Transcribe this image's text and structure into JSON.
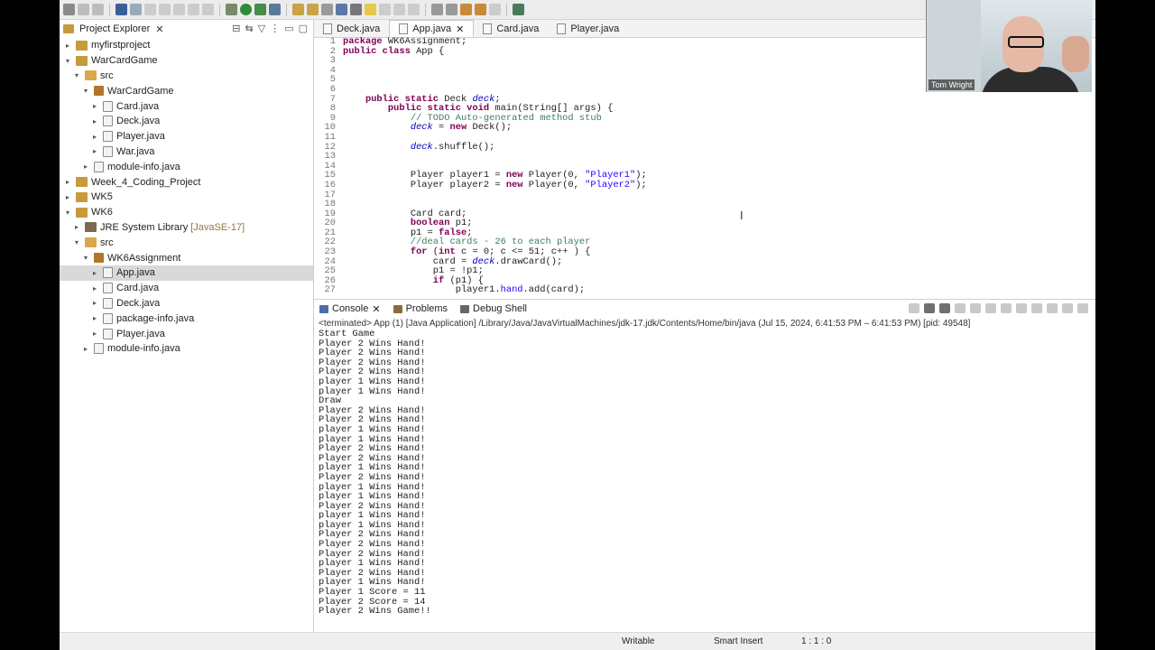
{
  "explorer": {
    "title": "Project Explorer",
    "tree": [
      {
        "label": "myfirstproject",
        "indent": 0,
        "chevron": "›",
        "icon": "proj"
      },
      {
        "label": "WarCardGame",
        "indent": 0,
        "chevron": "⌄",
        "icon": "proj"
      },
      {
        "label": "src",
        "indent": 1,
        "chevron": "⌄",
        "icon": "folder"
      },
      {
        "label": "WarCardGame",
        "indent": 2,
        "chevron": "⌄",
        "icon": "pkg"
      },
      {
        "label": "Card.java",
        "indent": 3,
        "chevron": "›",
        "icon": "file"
      },
      {
        "label": "Deck.java",
        "indent": 3,
        "chevron": "›",
        "icon": "file"
      },
      {
        "label": "Player.java",
        "indent": 3,
        "chevron": "›",
        "icon": "file"
      },
      {
        "label": "War.java",
        "indent": 3,
        "chevron": "›",
        "icon": "file"
      },
      {
        "label": "module-info.java",
        "indent": 2,
        "chevron": "›",
        "icon": "file"
      },
      {
        "label": "Week_4_Coding_Project",
        "indent": 0,
        "chevron": "›",
        "icon": "proj"
      },
      {
        "label": "WK5",
        "indent": 0,
        "chevron": "›",
        "icon": "proj"
      },
      {
        "label": "WK6",
        "indent": 0,
        "chevron": "⌄",
        "icon": "proj"
      },
      {
        "label": "JRE System Library",
        "suffix": "[JavaSE-17]",
        "indent": 1,
        "chevron": "›",
        "icon": "lib"
      },
      {
        "label": "src",
        "indent": 1,
        "chevron": "⌄",
        "icon": "folder"
      },
      {
        "label": "WK6Assignment",
        "indent": 2,
        "chevron": "⌄",
        "icon": "pkg"
      },
      {
        "label": "App.java",
        "indent": 3,
        "chevron": "›",
        "icon": "file",
        "selected": true
      },
      {
        "label": "Card.java",
        "indent": 3,
        "chevron": "›",
        "icon": "file"
      },
      {
        "label": "Deck.java",
        "indent": 3,
        "chevron": "›",
        "icon": "file"
      },
      {
        "label": "package-info.java",
        "indent": 3,
        "chevron": "›",
        "icon": "file"
      },
      {
        "label": "Player.java",
        "indent": 3,
        "chevron": "›",
        "icon": "file"
      },
      {
        "label": "module-info.java",
        "indent": 2,
        "chevron": "›",
        "icon": "file"
      }
    ]
  },
  "editor": {
    "tabs": [
      {
        "label": "Deck.java",
        "active": false
      },
      {
        "label": "App.java",
        "active": true
      },
      {
        "label": "Card.java",
        "active": false
      },
      {
        "label": "Player.java",
        "active": false
      }
    ],
    "code": [
      {
        "n": "1",
        "tokens": [
          [
            "kw",
            "package"
          ],
          [
            "ct",
            " WK6Assignment;"
          ]
        ]
      },
      {
        "n": "2",
        "tokens": [
          [
            "kw",
            "public class"
          ],
          [
            "ct",
            " App {"
          ]
        ]
      },
      {
        "n": "3",
        "tokens": []
      },
      {
        "n": "4",
        "tokens": []
      },
      {
        "n": "5",
        "tokens": []
      },
      {
        "n": "6",
        "tokens": []
      },
      {
        "n": "7",
        "tokens": [
          [
            "ct",
            "    "
          ],
          [
            "kw",
            "public static"
          ],
          [
            "ct",
            " Deck "
          ],
          [
            "fl",
            "deck"
          ],
          [
            "ct",
            ";"
          ]
        ]
      },
      {
        "n": "8",
        "tokens": [
          [
            "ct",
            "        "
          ],
          [
            "kw",
            "public static void"
          ],
          [
            "ct",
            " main(String[] args) {"
          ]
        ]
      },
      {
        "n": "9",
        "tokens": [
          [
            "ct",
            "            "
          ],
          [
            "cm",
            "// TODO Auto-generated method stub"
          ]
        ]
      },
      {
        "n": "10",
        "tokens": [
          [
            "ct",
            "            "
          ],
          [
            "fl",
            "deck"
          ],
          [
            "ct",
            " = "
          ],
          [
            "kw",
            "new"
          ],
          [
            "ct",
            " Deck();"
          ]
        ]
      },
      {
        "n": "11",
        "tokens": []
      },
      {
        "n": "12",
        "tokens": [
          [
            "ct",
            "            "
          ],
          [
            "fl",
            "deck"
          ],
          [
            "ct",
            ".shuffle();"
          ]
        ]
      },
      {
        "n": "13",
        "tokens": []
      },
      {
        "n": "14",
        "tokens": []
      },
      {
        "n": "15",
        "tokens": [
          [
            "ct",
            "            Player player1 = "
          ],
          [
            "kw",
            "new"
          ],
          [
            "ct",
            " Player(0, "
          ],
          [
            "st",
            "\"Player1\""
          ],
          [
            "ct",
            ");"
          ]
        ]
      },
      {
        "n": "16",
        "tokens": [
          [
            "ct",
            "            Player player2 = "
          ],
          [
            "kw",
            "new"
          ],
          [
            "ct",
            " Player(0, "
          ],
          [
            "st",
            "\"Player2\""
          ],
          [
            "ct",
            ");"
          ]
        ]
      },
      {
        "n": "17",
        "tokens": []
      },
      {
        "n": "18",
        "tokens": []
      },
      {
        "n": "19",
        "tokens": [
          [
            "ct",
            "            Card card;"
          ]
        ]
      },
      {
        "n": "20",
        "tokens": [
          [
            "ct",
            "            "
          ],
          [
            "kw",
            "boolean"
          ],
          [
            "ct",
            " p1;"
          ]
        ]
      },
      {
        "n": "21",
        "tokens": [
          [
            "ct",
            "            p1 = "
          ],
          [
            "kw",
            "false"
          ],
          [
            "ct",
            ";"
          ]
        ]
      },
      {
        "n": "22",
        "tokens": [
          [
            "ct",
            "            "
          ],
          [
            "cm",
            "//deal cards - 26 to each player"
          ]
        ]
      },
      {
        "n": "23",
        "tokens": [
          [
            "ct",
            "            "
          ],
          [
            "kw",
            "for"
          ],
          [
            "ct",
            " ("
          ],
          [
            "kw",
            "int"
          ],
          [
            "ct",
            " c = 0; c <= 51; c++ ) {"
          ]
        ]
      },
      {
        "n": "24",
        "tokens": [
          [
            "ct",
            "                card = "
          ],
          [
            "fl",
            "deck"
          ],
          [
            "ct",
            ".drawCard();"
          ]
        ]
      },
      {
        "n": "25",
        "tokens": [
          [
            "ct",
            "                p1 = !p1;"
          ]
        ]
      },
      {
        "n": "26",
        "tokens": [
          [
            "ct",
            "                "
          ],
          [
            "kw",
            "if"
          ],
          [
            "ct",
            " (p1) {"
          ]
        ]
      },
      {
        "n": "27",
        "tokens": [
          [
            "ct",
            "                    player1."
          ],
          [
            "st",
            "hand"
          ],
          [
            "ct",
            ".add(card);"
          ]
        ]
      }
    ]
  },
  "console": {
    "tabs": [
      {
        "label": "Console",
        "icon": "console-icon"
      },
      {
        "label": "Problems",
        "icon": "problems-icon"
      },
      {
        "label": "Debug Shell",
        "icon": "debug-shell-icon"
      }
    ],
    "terminated": "<terminated> App (1) [Java Application] /Library/Java/JavaVirtualMachines/jdk-17.jdk/Contents/Home/bin/java  (Jul 15, 2024, 6:41:53 PM – 6:41:53 PM) [pid: 49548]",
    "output": [
      "Start Game",
      "Player 2 Wins Hand!",
      "Player 2 Wins Hand!",
      "Player 2 Wins Hand!",
      "Player 2 Wins Hand!",
      "player 1 Wins Hand!",
      "player 1 Wins Hand!",
      "Draw",
      "Player 2 Wins Hand!",
      "Player 2 Wins Hand!",
      "player 1 Wins Hand!",
      "player 1 Wins Hand!",
      "Player 2 Wins Hand!",
      "Player 2 Wins Hand!",
      "player 1 Wins Hand!",
      "Player 2 Wins Hand!",
      "player 1 Wins Hand!",
      "player 1 Wins Hand!",
      "Player 2 Wins Hand!",
      "player 1 Wins Hand!",
      "player 1 Wins Hand!",
      "Player 2 Wins Hand!",
      "Player 2 Wins Hand!",
      "Player 2 Wins Hand!",
      "player 1 Wins Hand!",
      "Player 2 Wins Hand!",
      "player 1 Wins Hand!",
      "Player 1 Score = 11",
      "Player 2 Score = 14",
      "Player 2 Wins Game!!"
    ]
  },
  "status": {
    "writable": "Writable",
    "insert_mode": "Smart Insert",
    "position": "1 : 1 : 0"
  },
  "webcam": {
    "name": "Tom Wright"
  }
}
